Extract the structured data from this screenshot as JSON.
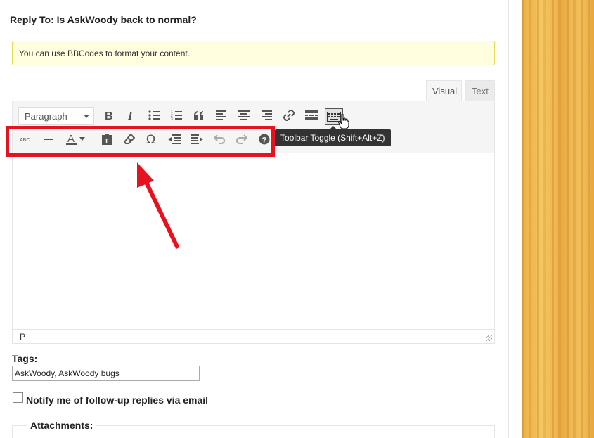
{
  "form": {
    "legend": "Reply To: Is AskWoody back to normal?",
    "notice": "You can use BBCodes to format your content."
  },
  "editor": {
    "tabs": [
      {
        "label": "Visual",
        "active": true
      },
      {
        "label": "Text",
        "active": false
      }
    ],
    "format_select": "Paragraph",
    "row1_icons": [
      "bold-icon",
      "italic-icon",
      "bullet-list-icon",
      "numbered-list-icon",
      "blockquote-icon",
      "align-left-icon",
      "align-center-icon",
      "align-right-icon",
      "link-icon",
      "read-more-icon",
      "toolbar-toggle-icon"
    ],
    "row2_icons": [
      "strikethrough-icon",
      "horizontal-line-icon",
      "text-color-icon",
      "paste-as-text-icon",
      "clear-formatting-icon",
      "special-character-icon",
      "outdent-icon",
      "indent-icon",
      "undo-icon",
      "redo-icon",
      "help-icon"
    ],
    "tooltip": "Toolbar Toggle (Shift+Alt+Z)",
    "status_path": "P",
    "highlight_color": "#e8111f",
    "toolbar_bg": "#f5f5f5"
  },
  "tags": {
    "label": "Tags:",
    "value": "AskWoody, AskWoody bugs"
  },
  "notify": {
    "label": "Notify me of follow-up replies via email",
    "checked": false
  },
  "attachments": {
    "label": "Attachments:"
  }
}
